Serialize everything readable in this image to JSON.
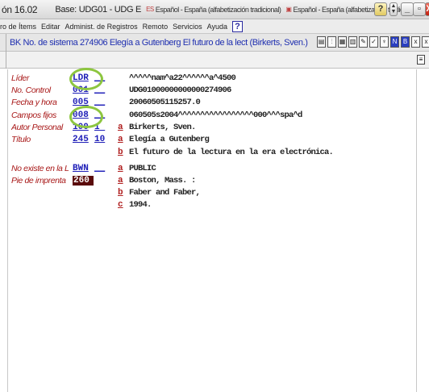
{
  "titlebar": {
    "version": "ón 16.02",
    "base": "Base: UDG01 - UDG E",
    "lang1_code": "ES",
    "lang1": "Español - España (alfabetización tradicional)",
    "lang2": "Español - España (alfabetización tradicional)",
    "help": "?",
    "min": "_",
    "max": "▫",
    "close": "X"
  },
  "menubar": {
    "items": [
      "ro de Ítems",
      "Editar",
      "Administ. de Registros",
      "Remoto",
      "Servicios",
      "Ayuda"
    ],
    "help_icon": "?"
  },
  "recbar": {
    "text": "BK No. de sistema 274906 Elegía a Gutenberg El futuro de la lect (Birkerts, Sven.)",
    "tool_icons": [
      "doc-icon",
      "split-icon",
      "grid-icon",
      "table-icon",
      "pen-icon",
      "check-icon",
      "tree-icon",
      "N",
      "B",
      "x",
      "x"
    ]
  },
  "record": {
    "rows": [
      {
        "label": "Líder",
        "tag": "LDR",
        "ind": "__",
        "sub": "",
        "value": "^^^^^nam^a22^^^^^^a^4500"
      },
      {
        "label": "No. Control",
        "tag": "001",
        "ind": "__",
        "sub": "",
        "value": "UDG01000000000000274906"
      },
      {
        "label": "Fecha y hora",
        "tag": "005",
        "ind": "__",
        "sub": "",
        "value": "20060505115257.0"
      },
      {
        "label": "Campos fijos",
        "tag": "008",
        "ind": "__",
        "sub": "",
        "value": "060505s2004^^^^^^^^^^^^^^^^^000^^^spa^d"
      },
      {
        "label": "Autor Personal",
        "tag": "100",
        "ind": "1 ",
        "sub": "a",
        "value": "Birkerts, Sven."
      },
      {
        "label": "Título",
        "tag": "245",
        "ind": "10",
        "sub": "a",
        "value": "Elegía a Gutenberg"
      },
      {
        "label": "",
        "tag": "",
        "ind": "",
        "sub": "b",
        "value": "El futuro de la lectura en la era electrónica."
      },
      {
        "label": "No existe en la L",
        "tag": "BWN",
        "ind": "__",
        "sub": "a",
        "value": "PUBLIC"
      },
      {
        "label": "Pie de imprenta",
        "tag": "260",
        "ind": "",
        "sub": "a",
        "value": "Boston, Mass. :"
      },
      {
        "label": "",
        "tag": "",
        "ind": "",
        "sub": "b",
        "value": "Faber and Faber,"
      },
      {
        "label": "",
        "tag": "",
        "ind": "",
        "sub": "c",
        "value": "1994."
      }
    ]
  },
  "colors": {
    "label": "#a81818",
    "tag": "#2020b8",
    "highlight_tag_bg": "#5a0b0b",
    "annotation_circle": "#8dc63f"
  }
}
